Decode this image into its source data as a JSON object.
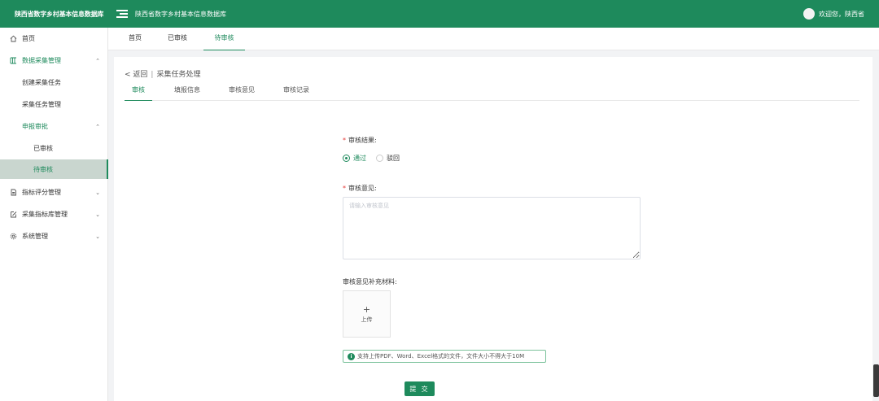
{
  "header": {
    "app_name": "陕西省数字乡村基本信息数据库",
    "title": "陕西省数字乡村基本信息数据库",
    "welcome": "欢迎您，陕西省"
  },
  "sidebar": {
    "items": [
      {
        "label": "首页",
        "icon": "home-icon"
      },
      {
        "label": "数据采集管理",
        "icon": "grid-icon"
      },
      {
        "label": "创建采集任务"
      },
      {
        "label": "采集任务管理"
      },
      {
        "label": "申报审批"
      },
      {
        "label": "已审核"
      },
      {
        "label": "待审核"
      },
      {
        "label": "指标评分管理",
        "icon": "document-icon"
      },
      {
        "label": "采集指标库管理",
        "icon": "edit-icon"
      },
      {
        "label": "系统管理",
        "icon": "gear-icon"
      }
    ]
  },
  "tags": [
    "首页",
    "已审核",
    "待审核"
  ],
  "breadcrumb": {
    "back": "< 返回",
    "sep": "|",
    "current": "采集任务处理"
  },
  "subtabs": [
    "审核",
    "填报信息",
    "审核意见",
    "审核记录"
  ],
  "form": {
    "result_label": "审核结果:",
    "options": [
      "通过",
      "驳回"
    ],
    "selected_option": "通过",
    "opinion_label": "审核意见:",
    "opinion_placeholder": "请输入审核意见",
    "attachments_label": "审核意见补充材料:",
    "upload_plus": "+",
    "upload_label": "上传",
    "upload_tip": "支持上传PDF、Word、Excel格式的文件，文件大小不得大于10M",
    "submit_label": "提 交"
  },
  "colors": {
    "brand": "#1e8a5c",
    "required": "#e53935",
    "selected_bg": "#c9d6cf"
  }
}
